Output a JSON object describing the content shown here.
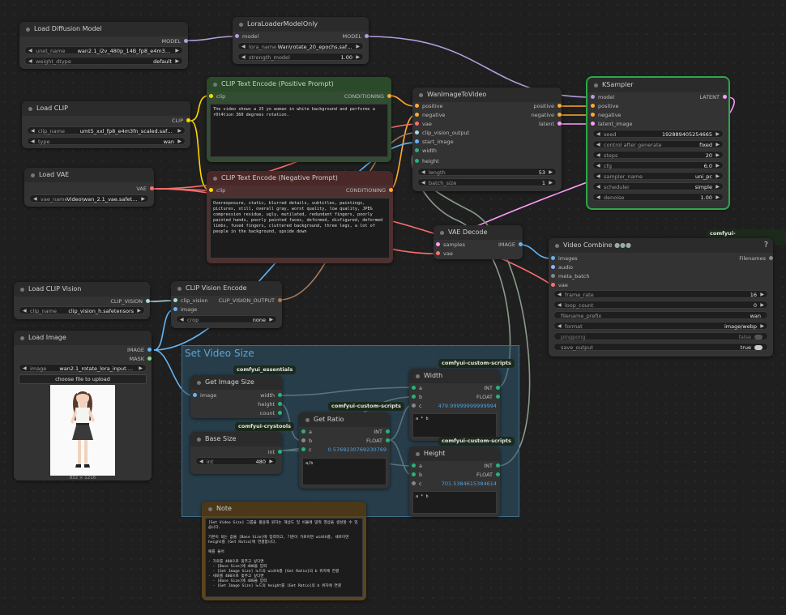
{
  "colors": {
    "model": "#b39ddb",
    "clip": "#ffd500",
    "conditioning": "#ffa931",
    "vae": "#ff6e6e",
    "clip_vision": "#a8dadc",
    "image": "#64b5f6",
    "latent": "#ff9cf9",
    "int": "#29b27a"
  },
  "group": {
    "title": "Set Video Size"
  },
  "load_diffusion": {
    "title": "Load Diffusion Model",
    "out_model": "MODEL",
    "unet_label": "unet_name",
    "unet_value": "wan2.1_i2v_480p_14B_fp8_e4m3fn.safet...",
    "dtype_label": "weight_dtype",
    "dtype_value": "default"
  },
  "lora": {
    "title": "LoraLoaderModelOnly",
    "in_model": "model",
    "out_model": "MODEL",
    "lora_label": "lora_name",
    "lora_value": "Wan\\rotate_20_epochs.safet...",
    "strength_label": "strength_model",
    "strength_value": "1.00"
  },
  "load_clip": {
    "title": "Load CLIP",
    "out_clip": "CLIP",
    "clip_label": "clip_name",
    "clip_value": "umt5_xxl_fp8_e4m3fn_scaled.safetensors",
    "type_label": "type",
    "type_value": "wan"
  },
  "load_vae": {
    "title": "Load VAE",
    "out_vae": "VAE",
    "vae_label": "vae_name",
    "vae_value": "Video\\wan_2.1_vae.safeten..."
  },
  "clip_pos": {
    "title": "CLIP Text Encode (Positive Prompt)",
    "in_clip": "clip",
    "out": "CONDITIONING",
    "text": "The video shows a 25 yo woman in white background and performs a r0t4tion 360 degrees rotation."
  },
  "clip_neg": {
    "title": "CLIP Text Encode (Negative Prompt)",
    "in_clip": "clip",
    "out": "CONDITIONING",
    "text": "Overexposure, static, blurred details, subtitles, paintings, pictures, still, overall gray, worst quality, low quality, JPEG compression residue, ugly, mutilated, redundant fingers, poorly painted hands, poorly painted faces, deformed, disfigured, deformed limbs, fused fingers, cluttered background, three legs, a lot of people in the background, upside down"
  },
  "wan": {
    "title": "WanImageToVideo",
    "in_positive": "positive",
    "in_negative": "negative",
    "in_vae": "vae",
    "in_clip_vision": "clip_vision_output",
    "in_start_image": "start_image",
    "in_width": "width",
    "in_height": "height",
    "out_positive": "positive",
    "out_negative": "negative",
    "out_latent": "latent",
    "length_label": "length",
    "length_value": "53",
    "batch_label": "batch_size",
    "batch_value": "1"
  },
  "ksampler": {
    "title": "KSampler",
    "in_model": "model",
    "in_positive": "positive",
    "in_negative": "negative",
    "in_latent": "latent_image",
    "out_latent": "LATENT",
    "widgets": [
      {
        "label": "seed",
        "value": "192889405254665"
      },
      {
        "label": "control after generate",
        "value": "fixed"
      },
      {
        "label": "steps",
        "value": "20"
      },
      {
        "label": "cfg",
        "value": "6.0"
      },
      {
        "label": "sampler_name",
        "value": "uni_pc"
      },
      {
        "label": "scheduler",
        "value": "simple"
      },
      {
        "label": "denoise",
        "value": "1.00"
      }
    ]
  },
  "vae_decode": {
    "title": "VAE Decode",
    "in_samples": "samples",
    "in_vae": "vae",
    "out_image": "IMAGE"
  },
  "video_combine": {
    "title": "Video Combine",
    "badge": "comfyui-videohelpersuite",
    "help": "?",
    "in_images": "images",
    "in_audio": "audio",
    "in_meta": "meta_batch",
    "in_vae": "vae",
    "out_filenames": "Filenames",
    "widgets": [
      {
        "label": "frame_rate",
        "value": "16"
      },
      {
        "label": "loop_count",
        "value": "0"
      },
      {
        "label": "filename_prefix",
        "value": "wan"
      },
      {
        "label": "format",
        "value": "image/webp"
      }
    ],
    "pingpong_label": "pingpong",
    "pingpong_value": "false",
    "save_label": "save_output",
    "save_value": "true"
  },
  "clip_vision_load": {
    "title": "Load CLIP Vision",
    "out": "CLIP_VISION",
    "label": "clip_name",
    "value": "clip_vision_h.safetensors"
  },
  "clip_vision_enc": {
    "title": "CLIP Vision Encode",
    "in_clip_vision": "clip_vision",
    "in_image": "image",
    "out": "CLIP_VISION_OUTPUT",
    "crop_label": "crop",
    "crop_value": "none"
  },
  "load_image": {
    "title": "Load Image",
    "out_image": "IMAGE",
    "out_mask": "MASK",
    "image_label": "image",
    "image_value": "wan2.1_rotate_lora_input.png",
    "upload": "choose file to upload",
    "size": "832 × 1216"
  },
  "get_image_size": {
    "title": "Get Image Size",
    "badge": "comfyui_essentials",
    "in_image": "image",
    "out_width": "width",
    "out_height": "height",
    "out_count": "count"
  },
  "base_size": {
    "title": "Base Size",
    "badge": "comfyui-crystools",
    "out_int": "int",
    "int_label": "int",
    "int_value": "480"
  },
  "get_ratio": {
    "title": "Get Ratio",
    "badge": "comfyui-custom-scripts",
    "in_a": "a",
    "in_b": "b",
    "in_c": "c",
    "out_int": "INT",
    "out_float": "FLOAT",
    "value": "0.5769230769230769",
    "expr": "a/b"
  },
  "width": {
    "title": "Width",
    "badge": "comfyui-custom-scripts",
    "in_a": "a",
    "in_b": "b",
    "in_c": "c",
    "out_int": "INT",
    "out_float": "FLOAT",
    "value": "479.99999999999994",
    "expr": "a * b"
  },
  "height": {
    "title": "Height",
    "badge": "comfyui-custom-scripts",
    "in_a": "a",
    "in_b": "b",
    "in_c": "c",
    "out_int": "INT",
    "out_float": "FLOAT",
    "value": "701.5384615384614",
    "expr": "a * b"
  },
  "note": {
    "title": "Note",
    "text": "[Set Video Size] 그룹을 활용해 원하는 해상도 및 비율에 맞춰 영상을 생성할 수 있습니다.\n\n기본이 되는 값을 [Base Size]에 입력하고, 기준이 가로이면 width를, 세로이면 height를 [Get Ratio]에 연결합니다.\n\n예를 들어\n\n- 가로를 480으로 맞추고 싶다면\n  - [Base Size]에 480을 입력\n  - [Get Image Size] 노드의 width를 [Get Ratio]의 b 위치에 연결\n- 세로를 480으로 맞추고 싶다면\n  - [Base Size]에 480을 입력\n  - [Get Image Size] 노드의 height를 [Get Ratio]의 b 위치에 연결"
  }
}
